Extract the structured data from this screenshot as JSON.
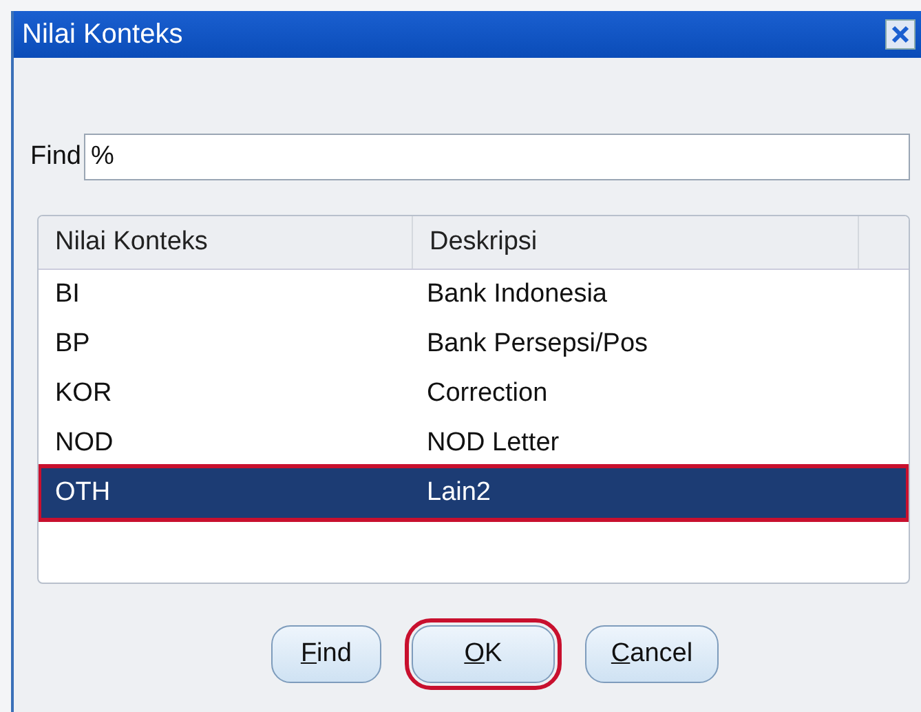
{
  "window": {
    "title": "Nilai Konteks"
  },
  "find": {
    "label": "Find",
    "value": "%"
  },
  "table": {
    "columns": [
      "Nilai Konteks",
      "Deskripsi"
    ],
    "rows": [
      {
        "cells": [
          "BI",
          "Bank Indonesia"
        ],
        "selected": false,
        "annotated": false
      },
      {
        "cells": [
          "BP",
          "Bank Persepsi/Pos"
        ],
        "selected": false,
        "annotated": false
      },
      {
        "cells": [
          "KOR",
          "Correction"
        ],
        "selected": false,
        "annotated": false
      },
      {
        "cells": [
          "NOD",
          "NOD Letter"
        ],
        "selected": false,
        "annotated": false
      },
      {
        "cells": [
          "OTH",
          "Lain2"
        ],
        "selected": true,
        "annotated": true
      }
    ]
  },
  "buttons": [
    {
      "label": "Find",
      "annotated": false
    },
    {
      "label": "OK",
      "annotated": true
    },
    {
      "label": "Cancel",
      "annotated": false
    }
  ]
}
